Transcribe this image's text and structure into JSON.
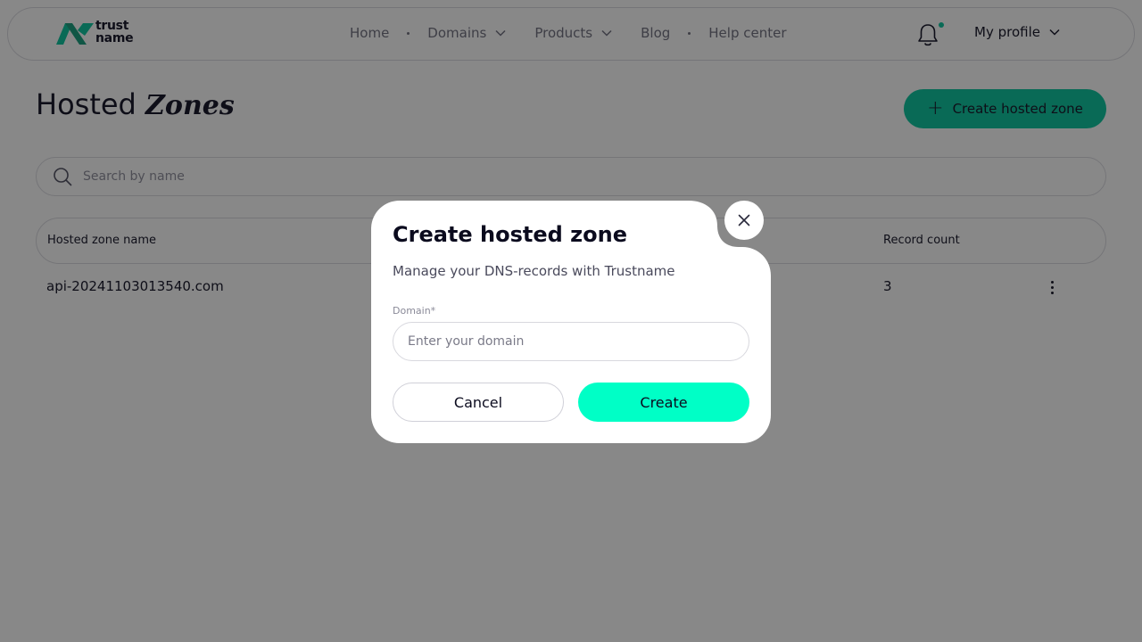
{
  "brand": {
    "line1": "trust",
    "line2": "name",
    "accent": "#00c39a"
  },
  "nav": {
    "items": [
      {
        "label": "Home"
      },
      {
        "label": "Domains"
      },
      {
        "label": "Products"
      },
      {
        "label": "Blog"
      },
      {
        "label": "Help center"
      }
    ],
    "profile_label": "My profile",
    "notification_icon": "bell-icon"
  },
  "page": {
    "title_plain": "Hosted",
    "title_italic": "Zones",
    "create_button_label": "Create hosted zone"
  },
  "search": {
    "placeholder": "Search by name"
  },
  "table": {
    "columns": [
      "Hosted zone name",
      "Record count"
    ],
    "rows": [
      {
        "name": "api-20241103013540.com",
        "record_count": "3"
      }
    ]
  },
  "modal": {
    "title": "Create hosted zone",
    "subtitle": "Manage your DNS-records with Trustname",
    "domain_label": "Domain*",
    "domain_placeholder": "Enter your domain",
    "domain_value": "",
    "cancel_label": "Cancel",
    "create_label": "Create",
    "create_color": "#00ffc6"
  }
}
